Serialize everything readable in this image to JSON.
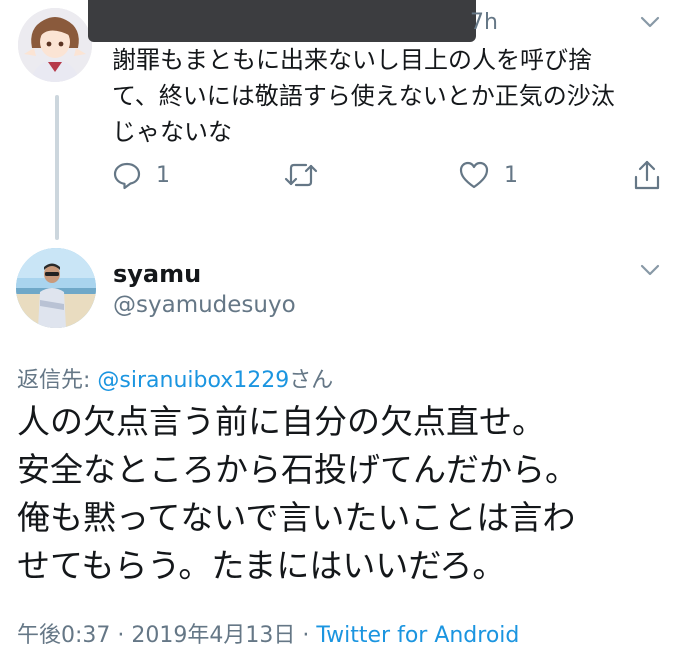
{
  "top_tweet": {
    "time": "7h",
    "text": "謝罪もまともに出来ないし目上の人を呼び捨\nて、終いには敬語すら使えないとか正気の沙汰\nじゃないな",
    "actions": {
      "reply_count": "1",
      "like_count": "1"
    }
  },
  "reply_tweet": {
    "display_name": "syamu",
    "handle": "@syamudesuyo",
    "reply_prefix": "返信先: ",
    "reply_mention": "@siranuibox1229",
    "reply_suffix": "さん",
    "text": "人の欠点言う前に自分の欠点直せ。\n安全なところから石投げてんだから。\n俺も黙ってないで言いたいことは言わ\nせてもらう。たまにはいいだろ。",
    "timestamp": "午後0:37 · 2019年4月13日 · ",
    "source": "Twitter for Android"
  },
  "icons": {
    "reply": "reply-icon",
    "retweet": "retweet-icon",
    "like": "heart-icon",
    "share": "share-icon",
    "more": "chevron-down-icon"
  },
  "colors": {
    "text": "#14171a",
    "secondary": "#657786",
    "link": "#1b95e0",
    "thread_line": "#ccd6dd"
  }
}
